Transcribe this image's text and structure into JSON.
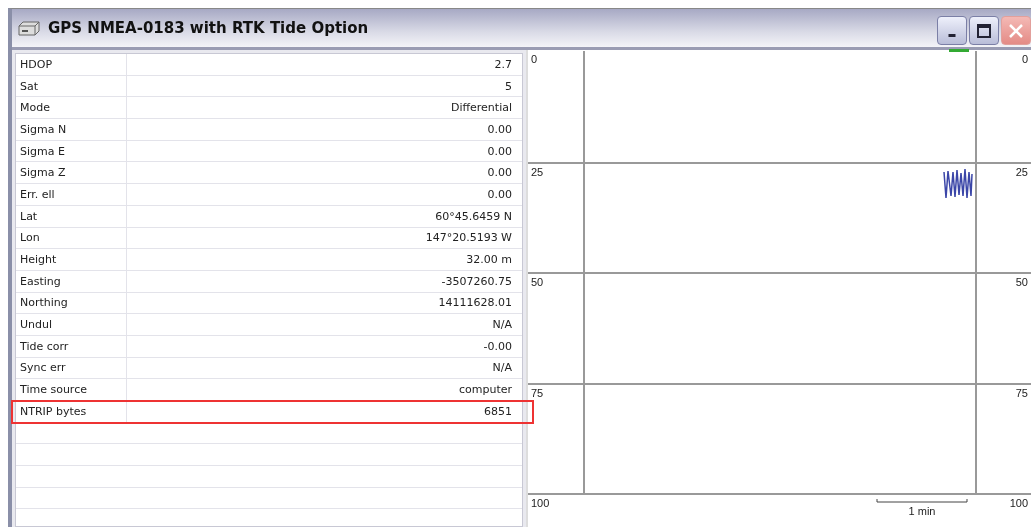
{
  "window": {
    "title": "GPS NMEA-0183 with RTK Tide Option",
    "buttons": [
      {
        "kind": "minimize"
      },
      {
        "kind": "maximize"
      },
      {
        "kind": "close"
      }
    ]
  },
  "table": {
    "rows": [
      {
        "label": "HDOP",
        "value": "2.7",
        "highlighted": false
      },
      {
        "label": "Sat",
        "value": "5",
        "highlighted": false
      },
      {
        "label": "Mode",
        "value": "Differential",
        "highlighted": false
      },
      {
        "label": "Sigma N",
        "value": "0.00",
        "highlighted": false
      },
      {
        "label": "Sigma E",
        "value": "0.00",
        "highlighted": false
      },
      {
        "label": "Sigma Z",
        "value": "0.00",
        "highlighted": false
      },
      {
        "label": "Err. ell",
        "value": "0.00",
        "highlighted": false
      },
      {
        "label": "Lat",
        "value": "60°45.6459 N",
        "highlighted": false
      },
      {
        "label": "Lon",
        "value": "147°20.5193 W",
        "highlighted": false
      },
      {
        "label": "Height",
        "value": "32.00 m",
        "highlighted": false
      },
      {
        "label": "Easting",
        "value": "-3507260.75",
        "highlighted": false
      },
      {
        "label": "Northing",
        "value": "14111628.01",
        "highlighted": false
      },
      {
        "label": "Undul",
        "value": "N/A",
        "highlighted": false
      },
      {
        "label": "Tide corr",
        "value": "-0.00",
        "highlighted": false
      },
      {
        "label": "Sync err",
        "value": "N/A",
        "highlighted": false
      },
      {
        "label": "Time source",
        "value": "computer",
        "highlighted": false
      },
      {
        "label": "NTRIP bytes",
        "value": "6851",
        "highlighted": true
      }
    ]
  },
  "chart": {
    "left_ticks": [
      "0",
      "25",
      "50",
      "75",
      "100"
    ],
    "right_ticks": [
      "0",
      "25",
      "50",
      "75",
      "100"
    ],
    "time_scale": "1 min"
  }
}
